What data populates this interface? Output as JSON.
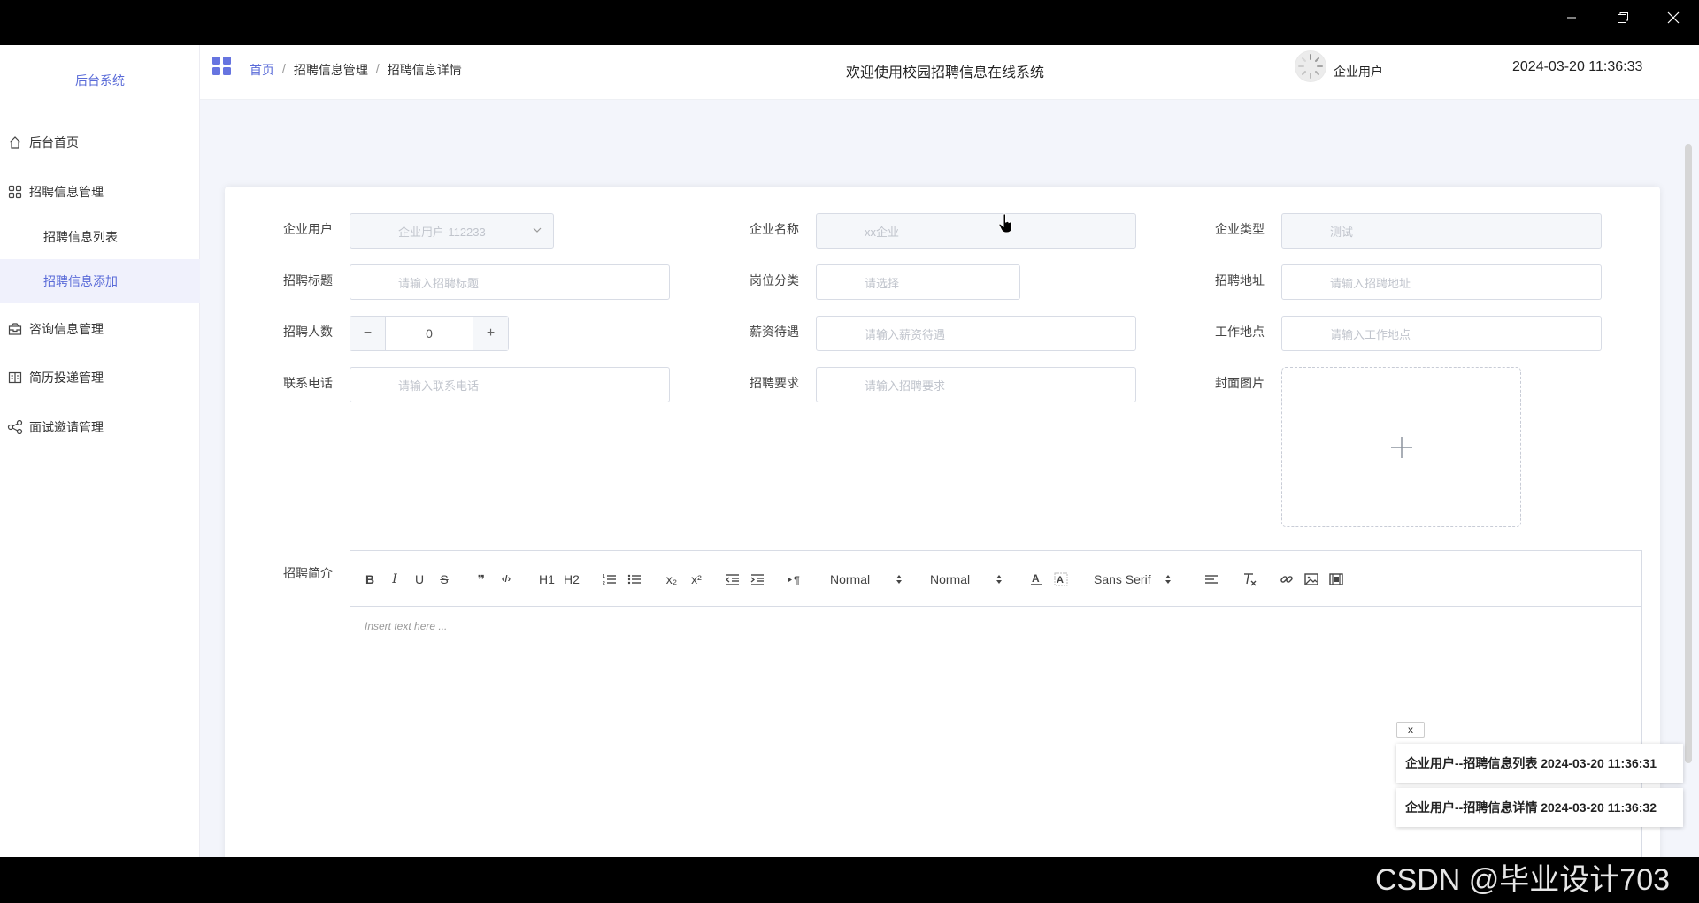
{
  "window": {
    "controls": [
      "minimize-icon",
      "restore-icon",
      "close-icon"
    ]
  },
  "sidebar": {
    "brand": "后台系统",
    "items": [
      {
        "label": "后台首页",
        "icon": "home-icon"
      },
      {
        "label": "招聘信息管理",
        "icon": "grid-icon"
      },
      {
        "label": "咨询信息管理",
        "icon": "inbox-icon"
      },
      {
        "label": "简历投递管理",
        "icon": "book-icon"
      },
      {
        "label": "面试邀请管理",
        "icon": "share-icon"
      }
    ],
    "subitems": [
      {
        "label": "招聘信息列表"
      },
      {
        "label": "招聘信息添加"
      }
    ],
    "active_subitem": "招聘信息添加"
  },
  "header": {
    "breadcrumb": [
      "首页",
      "招聘信息管理",
      "招聘信息详情"
    ],
    "breadcrumb_sep": "/",
    "welcome": "欢迎使用校园招聘信息在线系统",
    "user": "企业用户",
    "datetime": "2024-03-20 11:36:33"
  },
  "form": {
    "company_user": {
      "label": "企业用户",
      "value": "企业用户-112233"
    },
    "company_name": {
      "label": "企业名称",
      "placeholder": "xx企业"
    },
    "company_type": {
      "label": "企业类型",
      "placeholder": "测试"
    },
    "title": {
      "label": "招聘标题",
      "placeholder": "请输入招聘标题"
    },
    "category": {
      "label": "岗位分类",
      "placeholder": "请选择"
    },
    "address": {
      "label": "招聘地址",
      "placeholder": "请输入招聘地址"
    },
    "headcount": {
      "label": "招聘人数",
      "value": "0",
      "minus": "−",
      "plus": "+"
    },
    "salary": {
      "label": "薪资待遇",
      "placeholder": "请输入薪资待遇"
    },
    "location": {
      "label": "工作地点",
      "placeholder": "请输入工作地点"
    },
    "phone": {
      "label": "联系电话",
      "placeholder": "请输入联系电话"
    },
    "requirements": {
      "label": "招聘要求",
      "placeholder": "请输入招聘要求"
    },
    "cover": {
      "label": "封面图片"
    },
    "intro": {
      "label": "招聘简介",
      "placeholder": "Insert text here ..."
    }
  },
  "editor_toolbar": {
    "bold": "B",
    "italic": "I",
    "underline": "U",
    "strike": "S",
    "blockquote": "❞",
    "code": "‹/›",
    "h1": "H1",
    "h2": "H2",
    "sub": "x₂",
    "sup": "x²",
    "size_select": "Normal",
    "header_select": "Normal",
    "font_select": "Sans Serif"
  },
  "notifications": {
    "close_label": "x",
    "items": [
      "企业用户--招聘信息列表 2024-03-20 11:36:31",
      "企业用户--招聘信息详情 2024-03-20 11:36:32"
    ]
  },
  "watermark": "CSDN @毕业设计703"
}
